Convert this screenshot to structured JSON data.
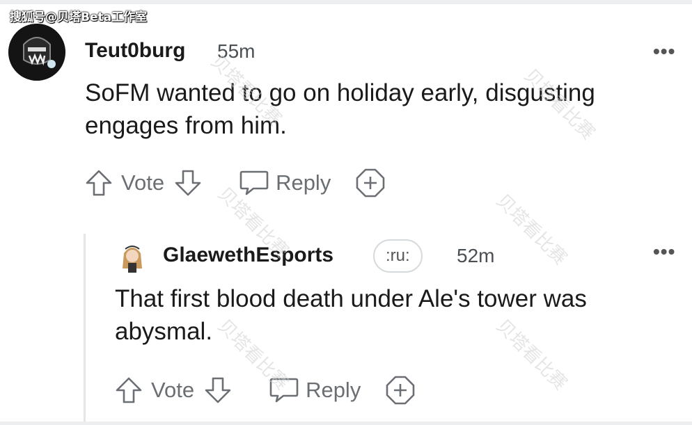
{
  "source_tag": "搜狐号@贝塔Beta工作室",
  "watermark_text": "贝塔看比赛",
  "comments": [
    {
      "username": "Teut0burg",
      "time": "55m",
      "body_line1": "SoFM wanted to go on holiday early, disgusting",
      "body_line2": "engages from him.",
      "vote_label": "Vote",
      "reply_label": "Reply",
      "more_label": "•••"
    },
    {
      "username": "GlaewethEsports",
      "flair": ":ru:",
      "time": "52m",
      "body_line1": "That first blood death under Ale's tower was",
      "body_line2": "abysmal.",
      "vote_label": "Vote",
      "reply_label": "Reply",
      "more_label": "•••"
    }
  ],
  "colors": {
    "text": "#1a1a1b",
    "meta": "#6b6f73",
    "border": "#eceef0"
  }
}
